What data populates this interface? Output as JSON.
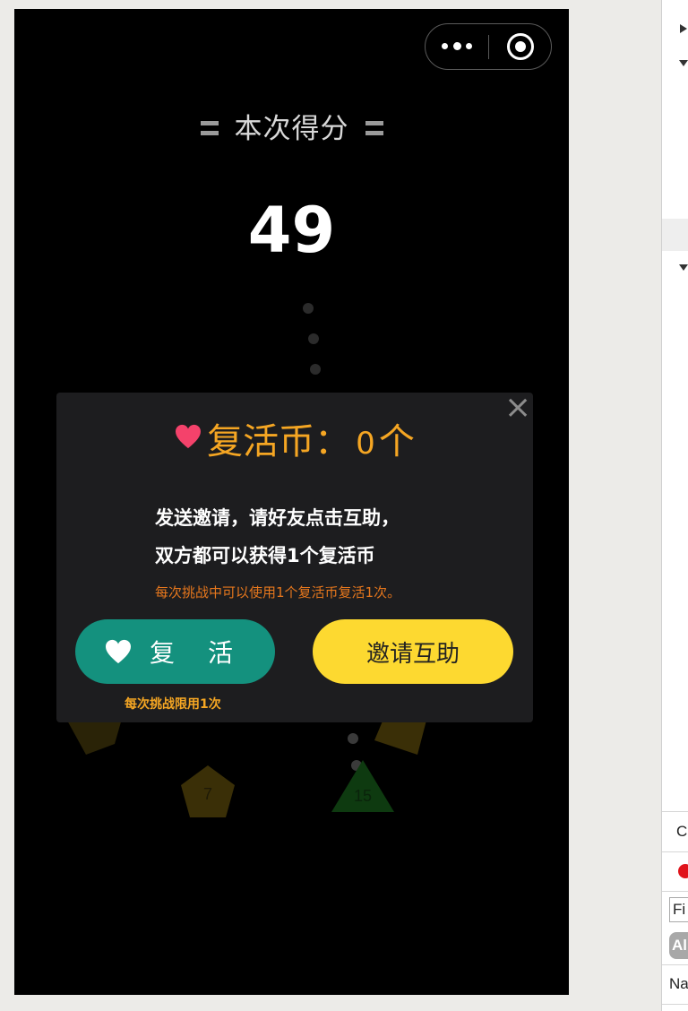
{
  "score": {
    "label": "本次得分",
    "value": "49"
  },
  "modal": {
    "title_prefix": "复活币：",
    "coin_count": "0",
    "title_suffix": "个",
    "close_symbol": "×",
    "invite_text_1": "发送邀请，请好友点击互助，",
    "invite_text_2": "双方都可以获得1个复活币",
    "rule_note": "每次挑战中可以使用1个复活币复活1次。",
    "revive_button": "复 活",
    "invite_button": "邀请互助",
    "limit_note": "每次挑战限用1次"
  },
  "background_shapes": [
    "7",
    "15"
  ],
  "devtools": {
    "console_tab": "C",
    "filter_placeholder": "Fi",
    "all_label": "Al",
    "name_column": "Na"
  },
  "colors": {
    "accent_orange": "#f5a623",
    "heart_pink": "#f4426b",
    "revive_green": "#14917e",
    "invite_yellow": "#fdd930"
  }
}
